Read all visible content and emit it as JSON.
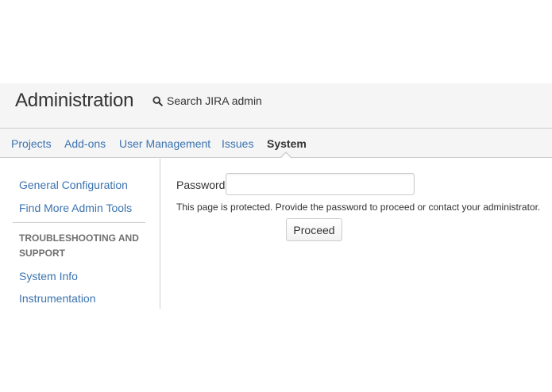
{
  "header": {
    "title": "Administration",
    "search_label": "Search JIRA admin",
    "search_icon": "search-icon"
  },
  "tabs": [
    {
      "label": "Projects",
      "active": false
    },
    {
      "label": "Add-ons",
      "active": false
    },
    {
      "label": "User Management",
      "active": false
    },
    {
      "label": "Issues",
      "active": false
    },
    {
      "label": "System",
      "active": true
    }
  ],
  "sidebar": {
    "links": [
      {
        "label": "General Configuration"
      },
      {
        "label": "Find More Admin Tools"
      }
    ],
    "section_heading": "TROUBLESHOOTING AND SUPPORT",
    "section_links": [
      {
        "label": "System Info"
      },
      {
        "label": "Instrumentation"
      }
    ]
  },
  "main": {
    "password_label": "Password",
    "password_value": "",
    "help_text": "This page is protected. Provide the password to proceed or contact your administrator.",
    "proceed_label": "Proceed"
  },
  "colors": {
    "link": "#3b73af",
    "text": "#333333",
    "header_bg": "#f5f5f5",
    "border": "#cccccc"
  }
}
